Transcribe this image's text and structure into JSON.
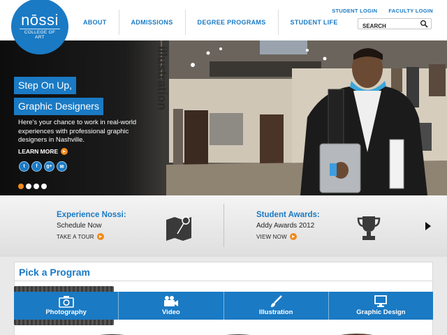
{
  "logo": {
    "word": "nōssi",
    "subtitle": "COLLEGE OF ART"
  },
  "nav": {
    "items": [
      "ABOUT",
      "ADMISSIONS",
      "DEGREE PROGRAMS",
      "STUDENT LIFE"
    ]
  },
  "utility": {
    "student_login": "STUDENT LOGIN",
    "faculty_login": "FACULTY LOGIN"
  },
  "search": {
    "placeholder": "SEARCH"
  },
  "hero": {
    "headline_1": "Step On Up,",
    "headline_2": "Graphic Designers",
    "body": "Here's your chance to work in real-world experiences with professional graphic designers in Nashville.",
    "learn_more": "LEARN MORE",
    "wall_text": "illustration",
    "social": [
      "twitter-icon",
      "facebook-icon",
      "google-plus-icon",
      "email-icon"
    ],
    "slides": 4,
    "active_slide": 1
  },
  "promo": {
    "left": {
      "title": "Experience Nossi:",
      "subtitle": "Schedule Now",
      "link": "TAKE A TOUR"
    },
    "right": {
      "title": "Student Awards:",
      "subtitle": "Addy Awards 2012",
      "link": "VIEW NOW"
    }
  },
  "program": {
    "title": "Pick a Program",
    "tabs": [
      "Photography",
      "Video",
      "Illustration",
      "Graphic Design"
    ],
    "active_tab": "Photography"
  },
  "colors": {
    "brand_blue": "#1a7ac4",
    "accent_orange": "#f08a1c"
  }
}
